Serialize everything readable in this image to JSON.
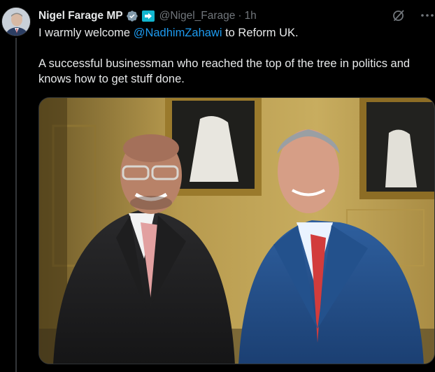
{
  "tweet": {
    "author_name": "Nigel Farage MP",
    "handle": "@Nigel_Farage",
    "separator": "·",
    "time": "1h",
    "text_line1_before": "I warmly welcome ",
    "mention": "@NadhimZahawi",
    "text_line1_after": " to Reform UK.",
    "text_paragraph2": "A successful businessman who reached the top of the tree in politics and knows how to get stuff done."
  },
  "icons": {
    "verified": "verified-badge-icon",
    "affiliation": "reform-uk-affiliate-icon",
    "grok": "grok-icon",
    "more": "more-icon"
  },
  "colors": {
    "background": "#000000",
    "text": "#e7e9ea",
    "muted": "#71767b",
    "link": "#1d9bf0"
  }
}
